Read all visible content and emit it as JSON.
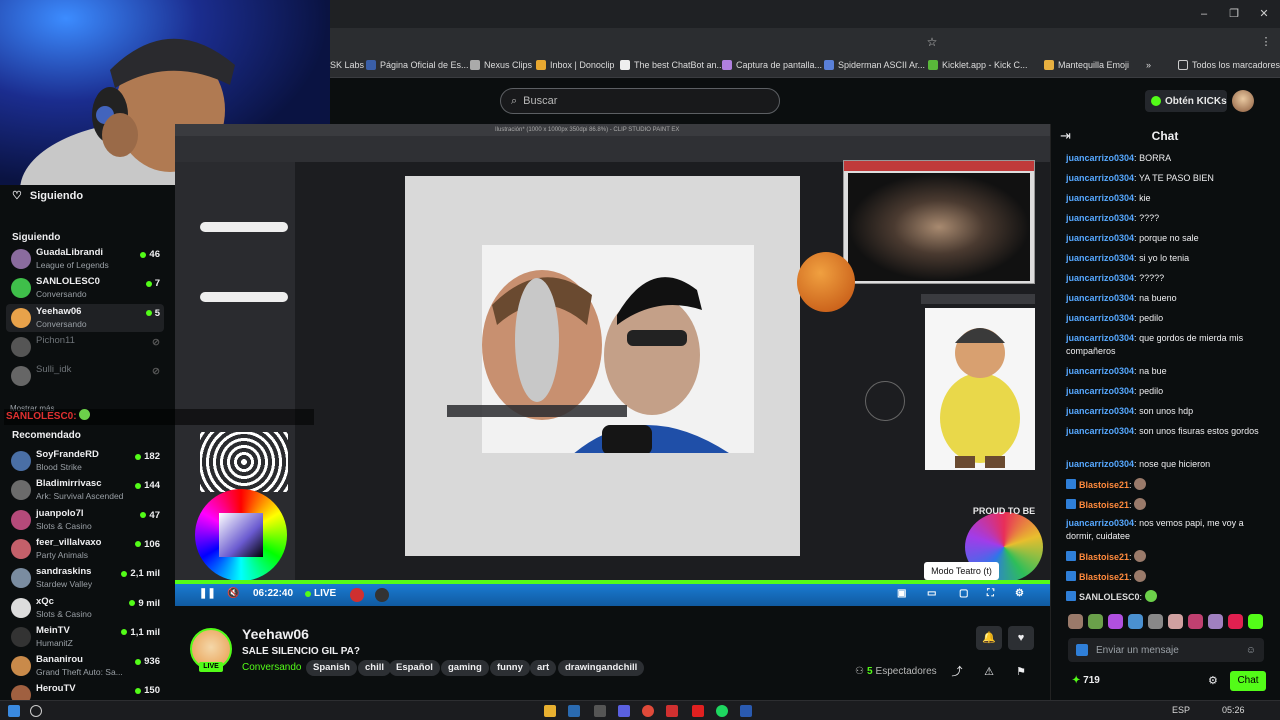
{
  "browser": {
    "bookmarks": [
      "SK Labs",
      "Página Oficial de Es...",
      "Nexus Clips",
      "Inbox | Donoclip",
      "The best ChatBot an...",
      "Captura de pantalla...",
      "Spiderman ASCII Ar...",
      "Kicklet.app - Kick C...",
      "Mantequilla Emoji",
      "»",
      "Todos los marcadores"
    ]
  },
  "header": {
    "search_placeholder": "Buscar",
    "kicks_label": "Obtén KICKs"
  },
  "sidebar": {
    "following_title": "Siguiendo",
    "following_heading": "Siguiendo",
    "following": [
      {
        "name": "GuadaLibrandi",
        "category": "League of Legends",
        "viewers": "46",
        "color": "#8a6b9e"
      },
      {
        "name": "SANLOLESC0",
        "category": "Conversando",
        "viewers": "7",
        "color": "#3fbf4a"
      },
      {
        "name": "Yeehaw06",
        "category": "Conversando",
        "viewers": "5",
        "color": "#e8a24a"
      },
      {
        "name": "Pichon11",
        "category": "",
        "viewers": "",
        "color": "#555"
      },
      {
        "name": "Sulli_idk",
        "category": "",
        "viewers": "",
        "color": "#666"
      }
    ],
    "show_more": "Mostrar más",
    "overlay_name": "SANLOLESC0:",
    "recommended_heading": "Recomendado",
    "recommended": [
      {
        "name": "SoyFrandeRD",
        "category": "Blood Strike",
        "viewers": "182",
        "color": "#4a6fa5"
      },
      {
        "name": "Bladimirrivasc",
        "category": "Ark: Survival Ascended",
        "viewers": "144",
        "color": "#6b6b6b"
      },
      {
        "name": "juanpolo7l",
        "category": "Slots & Casino",
        "viewers": "47",
        "color": "#b54a7a"
      },
      {
        "name": "feer_villalvaxo",
        "category": "Party Animals",
        "viewers": "106",
        "color": "#c4606a"
      },
      {
        "name": "sandraskins",
        "category": "Stardew Valley",
        "viewers": "2,1 mil",
        "color": "#7a8ca0"
      },
      {
        "name": "xQc",
        "category": "Slots & Casino",
        "viewers": "9 mil",
        "color": "#dcdcdc"
      },
      {
        "name": "MeinTV",
        "category": "HumanitZ",
        "viewers": "1,1 mil",
        "color": "#333"
      },
      {
        "name": "Bananirou",
        "category": "Grand Theft Auto: Sa...",
        "viewers": "936",
        "color": "#c98a4a"
      },
      {
        "name": "HerouTV",
        "category": "",
        "viewers": "150",
        "color": "#a06040"
      }
    ]
  },
  "player": {
    "app_title": "Ilustración* (1000 x 1000px 350dpi 86.8%) - CLIP STUDIO PAINT EX",
    "time": "06:22:40",
    "live": "LIVE",
    "tooltip": "Modo Teatro (t)",
    "sticker_text": "PROUD TO BE"
  },
  "stream": {
    "name": "Yeehaw06",
    "title": "SALE SILENCIO GIL PA?",
    "category": "Conversando",
    "live_badge": "LIVE",
    "tags": [
      "Spanish",
      "chill",
      "Español",
      "gaming",
      "funny",
      "art",
      "drawingandchill"
    ],
    "viewers_count": "5",
    "viewers_label": "Espectadores"
  },
  "chat": {
    "title": "Chat",
    "messages": [
      {
        "user": "juancarrizo0304",
        "text": "BORRA"
      },
      {
        "user": "juancarrizo0304",
        "text": "YA TE PASO BIEN"
      },
      {
        "user": "juancarrizo0304",
        "text": "kie"
      },
      {
        "user": "juancarrizo0304",
        "text": "????"
      },
      {
        "user": "juancarrizo0304",
        "text": "porque no sale"
      },
      {
        "user": "juancarrizo0304",
        "text": "si yo lo tenia"
      },
      {
        "user": "juancarrizo0304",
        "text": "?????"
      },
      {
        "user": "juancarrizo0304",
        "text": "na bueno"
      },
      {
        "user": "juancarrizo0304",
        "text": "pedilo"
      },
      {
        "user": "juancarrizo0304",
        "text": "que gordos de mierda mis compañeros"
      },
      {
        "user": "juancarrizo0304",
        "text": "na bue"
      },
      {
        "user": "juancarrizo0304",
        "text": "pedilo"
      },
      {
        "user": "juancarrizo0304",
        "text": "son unos hdp"
      },
      {
        "user": "juancarrizo0304",
        "text": "son unos fisuras estos gordos"
      },
      {
        "user": "juancarrizo0304",
        "text": "nose que hicieron"
      },
      {
        "user": "Blastoise21",
        "text": ""
      },
      {
        "user": "Blastoise21",
        "text": ""
      },
      {
        "user": "juancarrizo0304",
        "text": "nos vemos papi, me voy a dormir, cuidatee"
      },
      {
        "user": "Blastoise21",
        "text": ""
      },
      {
        "user": "Blastoise21",
        "text": ""
      },
      {
        "user": "SANLOLESC0",
        "text": ""
      }
    ],
    "input_placeholder": "Enviar un mensaje",
    "kicks_count": "719",
    "chat_button": "Chat"
  },
  "taskbar": {
    "lang": "ESP",
    "time": "05:26"
  }
}
